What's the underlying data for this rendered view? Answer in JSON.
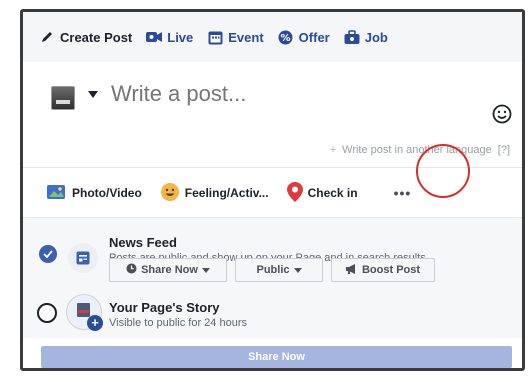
{
  "topbar": {
    "create_post": "Create Post",
    "live": "Live",
    "event": "Event",
    "offer": "Offer",
    "job": "Job"
  },
  "composer": {
    "placeholder": "Write a post...",
    "another_language": "Write post in another language",
    "help": "[?]"
  },
  "actions": {
    "photo_video": "Photo/Video",
    "feeling": "Feeling/Activ...",
    "check_in": "Check in",
    "more": "•••"
  },
  "options": {
    "news_feed_title": "News Feed",
    "news_feed_sub": "Posts are public and show up on your Page and in search results",
    "share_now_btn": "Share Now",
    "public_btn": "Public",
    "boost_btn": "Boost Post",
    "story_title": "Your Page's Story",
    "story_sub": "Visible to public for 24 hours"
  },
  "footer": {
    "share_now": "Share Now"
  },
  "colors": {
    "brand_blue": "#3b5fb1",
    "highlight_red": "#d62d2d",
    "disabled_button": "#a4b6df"
  }
}
